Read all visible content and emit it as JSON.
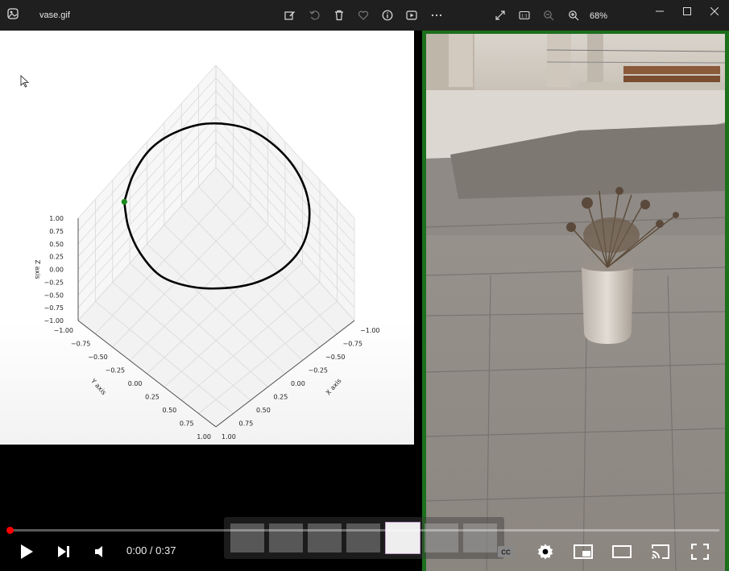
{
  "window": {
    "file_name": "vase.gif",
    "zoom": "68%",
    "toolbar_icons": [
      "edit-icon",
      "rotate-icon",
      "delete-icon",
      "favorite-icon",
      "info-icon",
      "slideshow-icon",
      "more-icon",
      "fit-icon",
      "actual-size-icon",
      "zoom-out-icon",
      "zoom-in-icon"
    ]
  },
  "player": {
    "time": "0:00 / 0:37",
    "progress": 0.0
  },
  "chart_data": {
    "type": "line3d",
    "zlabel": "Z axis",
    "ylabel": "Y axis",
    "xlabel": "X axis",
    "z_ticks": [
      "1.00",
      "0.75",
      "0.50",
      "0.25",
      "0.00",
      "−0.25",
      "−0.50",
      "−0.75",
      "−1.00"
    ],
    "y_ticks": [
      "−1.00",
      "−0.75",
      "−0.50",
      "−0.25",
      "0.00",
      "0.25",
      "0.50",
      "0.75",
      "1.00"
    ],
    "x_ticks": [
      "−1.00",
      "−0.75",
      "−0.50",
      "−0.25",
      "0.00",
      "0.25",
      "0.50",
      "0.75",
      "1.00"
    ],
    "xlim": [
      -1,
      1
    ],
    "ylim": [
      -1,
      1
    ],
    "zlim": [
      -1,
      1
    ],
    "series": [
      {
        "color": "#000000",
        "points": [
          [
            0.55,
            -0.78,
            0.9
          ],
          [
            0.3,
            -0.9,
            0.92
          ],
          [
            0.0,
            -0.95,
            0.92
          ],
          [
            -0.3,
            -0.88,
            0.9
          ],
          [
            -0.6,
            -0.7,
            0.88
          ],
          [
            -0.85,
            -0.4,
            0.86
          ],
          [
            -0.95,
            -0.05,
            0.85
          ],
          [
            -0.92,
            0.3,
            0.84
          ],
          [
            -0.75,
            0.6,
            0.84
          ],
          [
            -0.45,
            0.82,
            0.85
          ],
          [
            -0.1,
            0.9,
            0.86
          ],
          [
            0.25,
            0.85,
            0.87
          ],
          [
            0.55,
            0.68,
            0.88
          ],
          [
            0.78,
            0.42,
            0.88
          ],
          [
            0.9,
            0.1,
            0.89
          ],
          [
            0.85,
            -0.25,
            0.9
          ],
          [
            0.72,
            -0.55,
            0.9
          ],
          [
            0.55,
            -0.78,
            0.9
          ]
        ]
      },
      {
        "color": "#1a8a1a",
        "marker": true,
        "points": [
          [
            0.55,
            -0.78,
            0.9
          ]
        ]
      }
    ],
    "grid": true
  }
}
